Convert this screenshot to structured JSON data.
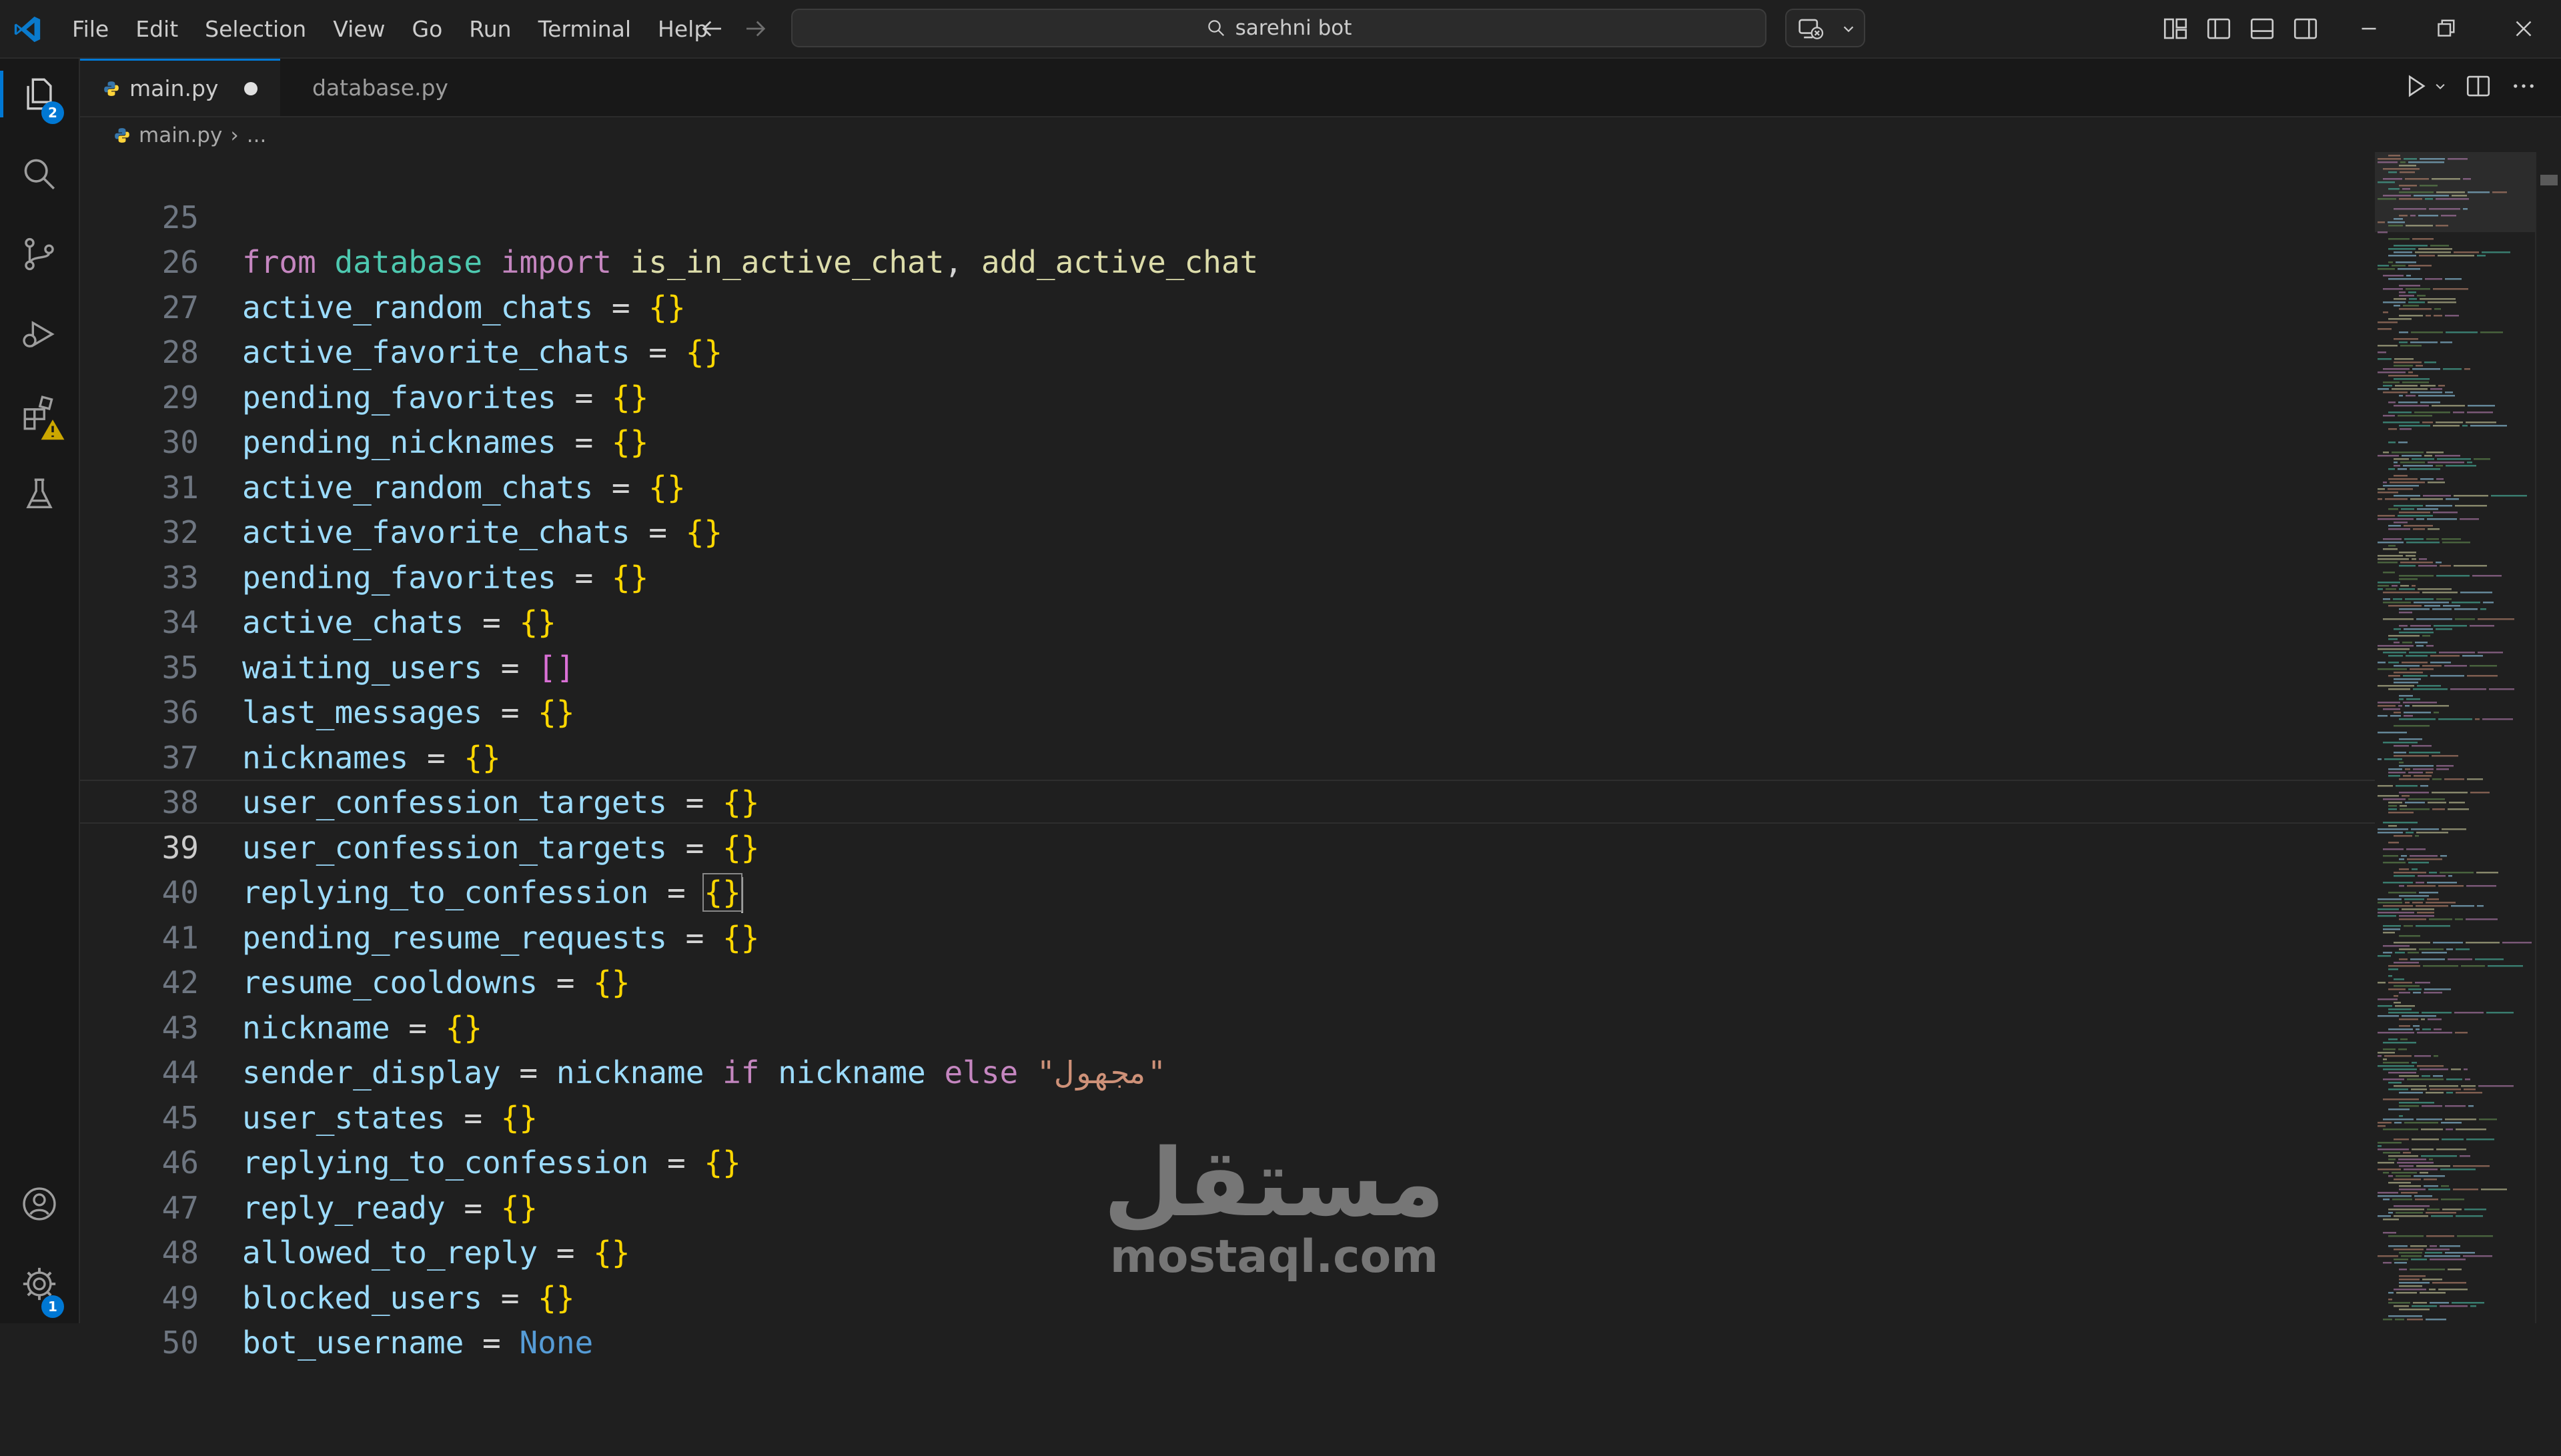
{
  "menu": [
    "File",
    "Edit",
    "Selection",
    "View",
    "Go",
    "Run",
    "Terminal",
    "Help"
  ],
  "search": {
    "text": "sarehni bot"
  },
  "badges": {
    "explorer": "2",
    "accounts": "1"
  },
  "tabs": [
    {
      "label": "main.py",
      "modified": true,
      "active": true
    },
    {
      "label": "database.py",
      "modified": true,
      "active": false
    }
  ],
  "breadcrumb": {
    "file": "main.py",
    "rest": "..."
  },
  "editor": {
    "current_line": "39",
    "lines": [
      {
        "n": "25"
      },
      {
        "n": "26"
      },
      {
        "n": "27"
      },
      {
        "n": "28"
      },
      {
        "n": "29"
      },
      {
        "n": "30"
      },
      {
        "n": "31"
      },
      {
        "n": "32"
      },
      {
        "n": "33"
      },
      {
        "n": "34"
      },
      {
        "n": "35"
      },
      {
        "n": "36"
      },
      {
        "n": "37"
      },
      {
        "n": "38"
      },
      {
        "n": "39"
      },
      {
        "n": "40"
      },
      {
        "n": "41"
      },
      {
        "n": "42"
      },
      {
        "n": "43"
      },
      {
        "n": "44"
      },
      {
        "n": "45"
      },
      {
        "n": "46"
      },
      {
        "n": "47"
      },
      {
        "n": "48"
      },
      {
        "n": "49"
      },
      {
        "n": "50"
      }
    ],
    "tokens": {
      "t25": [
        "from",
        "database",
        "import",
        "is_in_active_chat",
        ", ",
        "add_active_chat"
      ],
      "t26": "active_random_chats",
      "t27": "active_favorite_chats",
      "t28": "pending_favorites",
      "t29": "pending_nicknames",
      "t30": "active_random_chats",
      "t31": "active_favorite_chats",
      "t32": "pending_favorites",
      "t33": "active_chats",
      "t34": "waiting_users",
      "t35": "last_messages",
      "t36": "nicknames",
      "t37": "user_confession_targets",
      "t38": "user_confession_targets",
      "t39": "replying_to_confession",
      "t40": "pending_resume_requests",
      "t41": "resume_cooldowns",
      "t42": "nickname",
      "t43": [
        "sender_display",
        "nickname",
        "if",
        "nickname",
        "else",
        "\"مجهول\""
      ],
      "t44": "user_states",
      "t45": "replying_to_confession",
      "t46": "reply_ready",
      "t47": "allowed_to_reply",
      "t48": "blocked_users",
      "t49": [
        "bot_username",
        "None"
      ],
      "eq": " = ",
      "braces": "{}",
      "brackets": "[]"
    }
  },
  "watermark": {
    "arabic": "مستقل",
    "latin": "mostaql.com"
  },
  "colors": {
    "accent": "#0078d4",
    "background": "#1f1f1f",
    "keyword": "#c586c0",
    "variable": "#9cdcfe"
  }
}
